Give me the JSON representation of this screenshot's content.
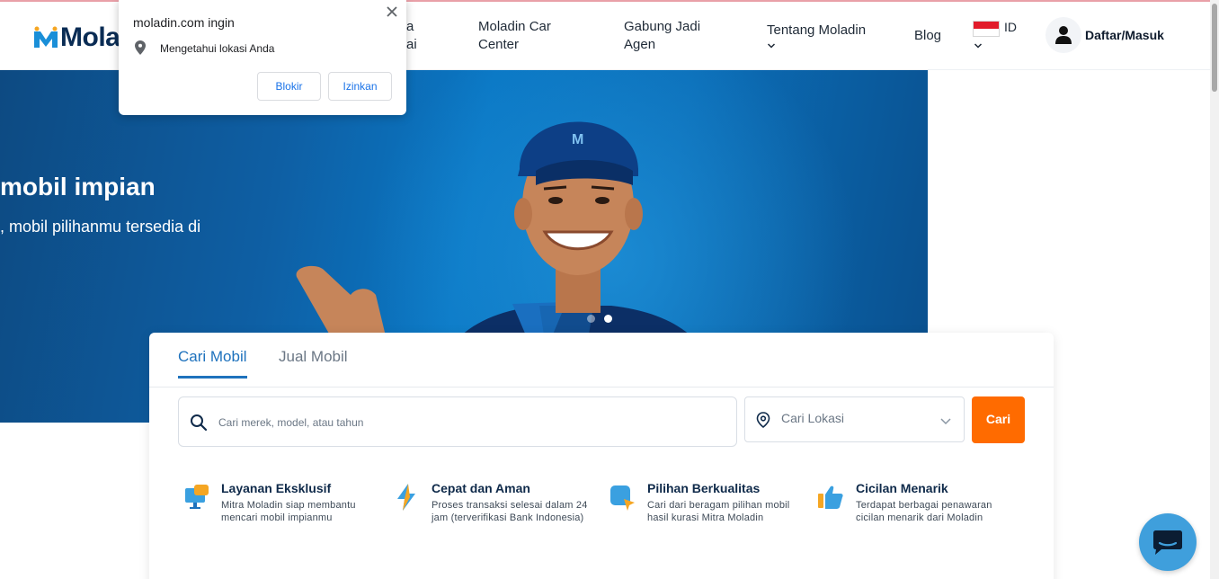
{
  "header": {
    "logo_text": "Molad",
    "nav": {
      "partial_line1": "a",
      "partial_line2": "ai",
      "car_center": "Moladin Car Center",
      "agen": "Gabung Jadi Agen",
      "tentang": "Tentang Moladin",
      "blog": "Blog"
    },
    "language": "ID",
    "login_label": "Daftar/Masuk"
  },
  "hero": {
    "title": "mobil impian",
    "subtitle": ", mobil pilihanmu tersedia di",
    "slides_total": 2,
    "active_slide": 2
  },
  "search_card": {
    "tabs": [
      {
        "label": "Cari Mobil",
        "active": true
      },
      {
        "label": "Jual Mobil",
        "active": false
      }
    ],
    "search_placeholder": "Cari merek, model, atau tahun",
    "location_label": "Cari Lokasi",
    "search_button": "Cari",
    "features": [
      {
        "title": "Layanan Eksklusif",
        "desc": "Mitra Moladin siap membantu mencari mobil impianmu",
        "icon": "monitor-person-icon"
      },
      {
        "title": "Cepat dan Aman",
        "desc": "Proses transaksi selesai dalam 24 jam (terverifikasi Bank Indonesia)",
        "icon": "lightning-icon"
      },
      {
        "title": "Pilihan Berkualitas",
        "desc": "Cari dari beragam pilihan mobil hasil kurasi Mitra Moladin",
        "icon": "quality-badge-icon"
      },
      {
        "title": "Cicilan Menarik",
        "desc": "Terdapat berbagai penawaran cicilan menarik dari Moladin",
        "icon": "thumbs-up-icon"
      }
    ]
  },
  "permission_popup": {
    "title": "moladin.com ingin",
    "permission": "Mengetahui lokasi Anda",
    "block_label": "Blokir",
    "allow_label": "Izinkan"
  },
  "colors": {
    "brand_blue": "#1e72bd",
    "accent_orange": "#ff6b00",
    "navy": "#0a2c54",
    "chat_blue": "#3f9fdc"
  }
}
